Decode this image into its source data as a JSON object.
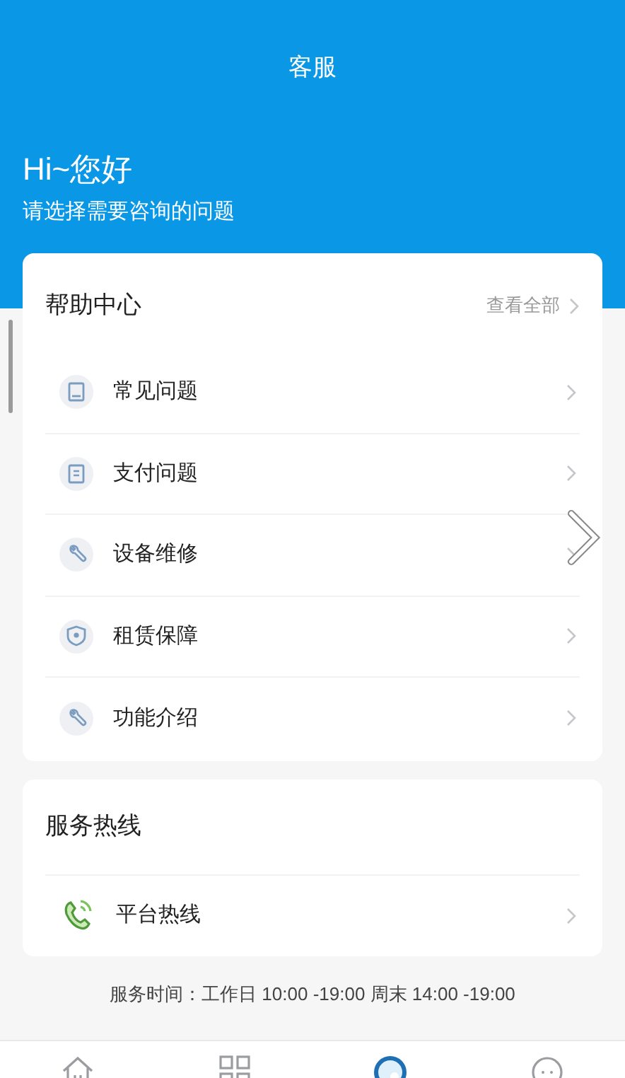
{
  "header": {
    "title": "客服",
    "greeting": "Hi~您好",
    "subtitle": "请选择需要咨询的问题"
  },
  "help_center": {
    "title": "帮助中心",
    "view_all": "查看全部",
    "items": [
      {
        "label": "常见问题",
        "kind": "book"
      },
      {
        "label": "支付问题",
        "kind": "receipt"
      },
      {
        "label": "设备维修",
        "kind": "wrench"
      },
      {
        "label": "租赁保障",
        "kind": "shield"
      },
      {
        "label": "功能介绍",
        "kind": "wrench"
      }
    ]
  },
  "hotline": {
    "title": "服务热线",
    "items": [
      {
        "label": "平台热线",
        "kind": "phone"
      }
    ]
  },
  "service_hours": "服务时间：工作日 10:00 -19:00 周末 14:00 -19:00",
  "tab_bar": [
    {
      "kind": "home",
      "selected": false
    },
    {
      "kind": "grid",
      "selected": false
    },
    {
      "kind": "service",
      "selected": true
    },
    {
      "kind": "chat",
      "selected": false
    }
  ]
}
